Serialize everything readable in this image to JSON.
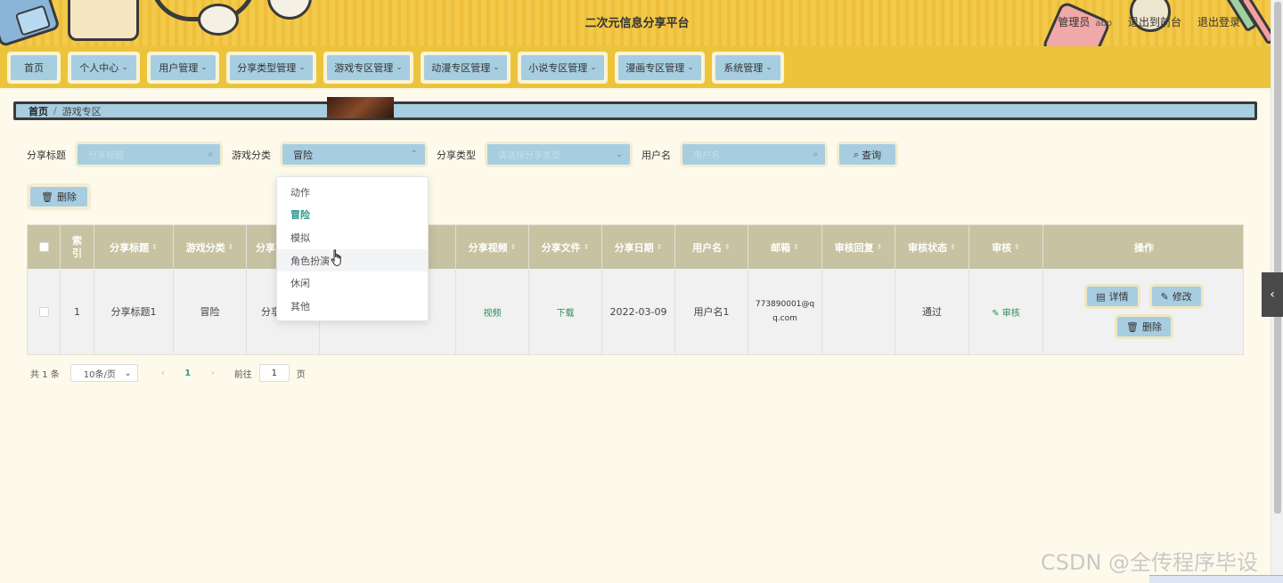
{
  "header": {
    "title": "二次元信息分享平台",
    "role": "管理员",
    "username": "abo",
    "to_front": "退出到前台",
    "logout": "退出登录"
  },
  "nav": {
    "items": [
      {
        "label": "首页",
        "has_menu": false
      },
      {
        "label": "个人中心",
        "has_menu": true
      },
      {
        "label": "用户管理",
        "has_menu": true
      },
      {
        "label": "分享类型管理",
        "has_menu": true
      },
      {
        "label": "游戏专区管理",
        "has_menu": true
      },
      {
        "label": "动漫专区管理",
        "has_menu": true
      },
      {
        "label": "小说专区管理",
        "has_menu": true
      },
      {
        "label": "漫画专区管理",
        "has_menu": true
      },
      {
        "label": "系统管理",
        "has_menu": true
      }
    ]
  },
  "breadcrumb": {
    "home": "首页",
    "separator": "/",
    "current": "游戏专区"
  },
  "filters": {
    "title_label": "分享标题",
    "title_placeholder": "分享标题",
    "category_label": "游戏分类",
    "category_value": "冒险",
    "type_label": "分享类型",
    "type_placeholder": "请选择分享类型",
    "user_label": "用户名",
    "user_placeholder": "用户名",
    "query_button": "查询"
  },
  "actions": {
    "delete_button": "删除"
  },
  "dropdown": {
    "options": [
      "动作",
      "冒险",
      "模拟",
      "角色扮演",
      "休闲",
      "其他"
    ],
    "selected": "冒险",
    "hovered": "角色扮演"
  },
  "table": {
    "headers": [
      "索引",
      "分享标题",
      "游戏分类",
      "分享",
      "",
      "分享视频",
      "分享文件",
      "分享日期",
      "用户名",
      "邮箱",
      "审核回复",
      "审核状态",
      "审核",
      "操作"
    ],
    "rows": [
      {
        "index": "1",
        "title": "分享标题1",
        "category": "冒险",
        "type": "分享",
        "video": "视频",
        "file": "下载",
        "date": "2022-03-09",
        "user": "用户名1",
        "email_line1": "773890001@q",
        "email_line2": "q.com",
        "reply": "",
        "status": "通过",
        "review": "审核",
        "ops": {
          "detail": "详情",
          "edit": "修改",
          "delete": "删除"
        }
      }
    ]
  },
  "pagination": {
    "total_prefix": "共",
    "total": "1",
    "total_suffix": "条",
    "page_size": "10条/页",
    "prev": "‹",
    "current": "1",
    "next": "›",
    "goto_label": "前往",
    "goto_value": "1",
    "goto_suffix": "页"
  },
  "watermark": "CSDN @全传程序毕设",
  "colors": {
    "header_yellow": "#f2c94a",
    "button_blue": "#a7cde0",
    "table_header": "#c7c2a1",
    "accent_green": "#2e8b57"
  }
}
